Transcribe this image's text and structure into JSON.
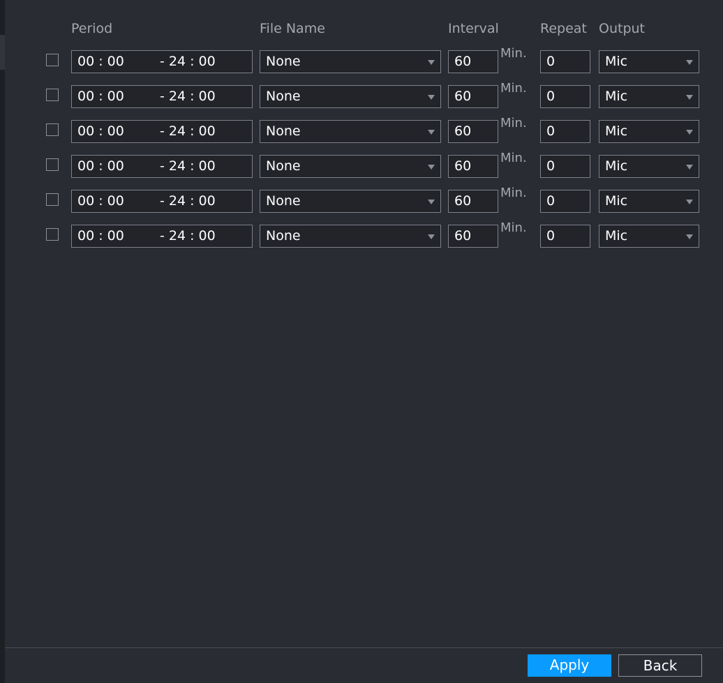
{
  "headers": {
    "period": "Period",
    "file_name": "File Name",
    "interval": "Interval",
    "repeat": "Repeat",
    "output": "Output"
  },
  "rows": [
    {
      "checked": false,
      "start": "00 : 00",
      "end": "- 24 : 00",
      "file": "None",
      "interval": "60",
      "unit": "Min.",
      "repeat": "0",
      "output": "Mic"
    },
    {
      "checked": false,
      "start": "00 : 00",
      "end": "- 24 : 00",
      "file": "None",
      "interval": "60",
      "unit": "Min.",
      "repeat": "0",
      "output": "Mic"
    },
    {
      "checked": false,
      "start": "00 : 00",
      "end": "- 24 : 00",
      "file": "None",
      "interval": "60",
      "unit": "Min.",
      "repeat": "0",
      "output": "Mic"
    },
    {
      "checked": false,
      "start": "00 : 00",
      "end": "- 24 : 00",
      "file": "None",
      "interval": "60",
      "unit": "Min.",
      "repeat": "0",
      "output": "Mic"
    },
    {
      "checked": false,
      "start": "00 : 00",
      "end": "- 24 : 00",
      "file": "None",
      "interval": "60",
      "unit": "Min.",
      "repeat": "0",
      "output": "Mic"
    },
    {
      "checked": false,
      "start": "00 : 00",
      "end": "- 24 : 00",
      "file": "None",
      "interval": "60",
      "unit": "Min.",
      "repeat": "0",
      "output": "Mic"
    }
  ],
  "footer": {
    "apply_label": "Apply",
    "back_label": "Back"
  },
  "colors": {
    "background": "#2a2c34",
    "accent": "#0a9bff"
  }
}
